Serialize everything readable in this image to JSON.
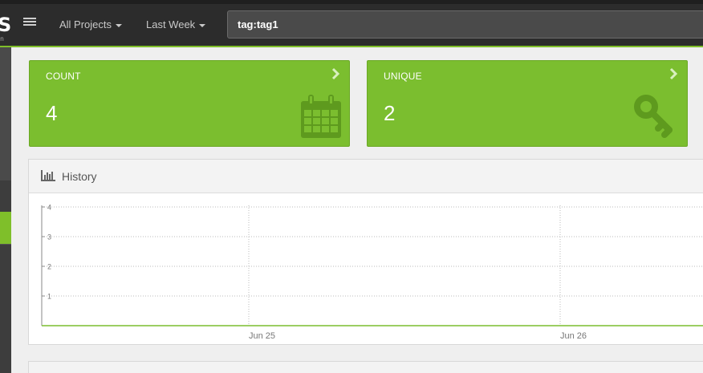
{
  "logo": {
    "letter": "S",
    "tagline": "ion"
  },
  "topbar": {
    "projects_label": "All Projects",
    "range_label": "Last Week",
    "search_value": "tag:tag1"
  },
  "cards": [
    {
      "label": "COUNT",
      "value": "4",
      "icon": "calendar-icon"
    },
    {
      "label": "UNIQUE",
      "value": "2",
      "icon": "key-icon"
    }
  ],
  "history": {
    "title": "History",
    "icon": "bar-chart-icon"
  },
  "chart_data": {
    "type": "line",
    "x": [
      "Jun 25",
      "Jun 26"
    ],
    "y_ticks": [
      1,
      2,
      3,
      4
    ],
    "ylim": [
      0,
      4
    ],
    "grid": true,
    "series": []
  },
  "colors": {
    "accent": "#7bbe2f",
    "topbar": "#2c2c2c"
  }
}
